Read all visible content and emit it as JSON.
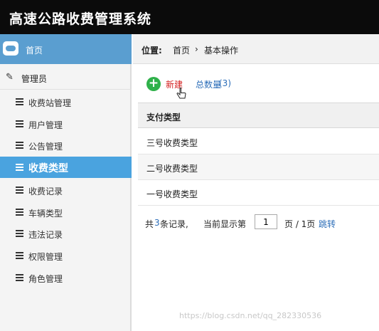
{
  "header": {
    "title": "高速公路收费管理系统"
  },
  "sidebar": {
    "home_label": "首页",
    "admin_label": "管理员",
    "items": [
      {
        "label": "收费站管理",
        "active": false
      },
      {
        "label": "用户管理",
        "active": false
      },
      {
        "label": "公告管理",
        "active": false
      },
      {
        "label": "收费类型",
        "active": true
      },
      {
        "label": "收费记录",
        "active": false
      },
      {
        "label": "车辆类型",
        "active": false
      },
      {
        "label": "违法记录",
        "active": false
      },
      {
        "label": "权限管理",
        "active": false
      },
      {
        "label": "角色管理",
        "active": false
      }
    ]
  },
  "breadcrumb": {
    "label": "位置:",
    "home": "首页",
    "separator": "›",
    "current": "基本操作"
  },
  "toolbar": {
    "add_label": "新建",
    "total_label": "总数量",
    "total_count": "(3)"
  },
  "table": {
    "header": "支付类型",
    "rows": [
      "三号收费类型",
      "二号收费类型",
      "一号收费类型"
    ]
  },
  "pager": {
    "prefix": "共",
    "count": "3",
    "suffix": "条记录,",
    "current_label": "当前显示第",
    "page_value": "1",
    "page_of": "页 / 1页",
    "jump_label": "跳转"
  },
  "watermark": "https://blog.csdn.net/qq_282330536",
  "colors": {
    "topbar": "#0b0b0b",
    "home_bg": "#5a9ed0",
    "active_bg": "#4aa3df",
    "add_icon": "#2fb14a",
    "link": "#2b6db8",
    "add_text": "#d42020"
  }
}
